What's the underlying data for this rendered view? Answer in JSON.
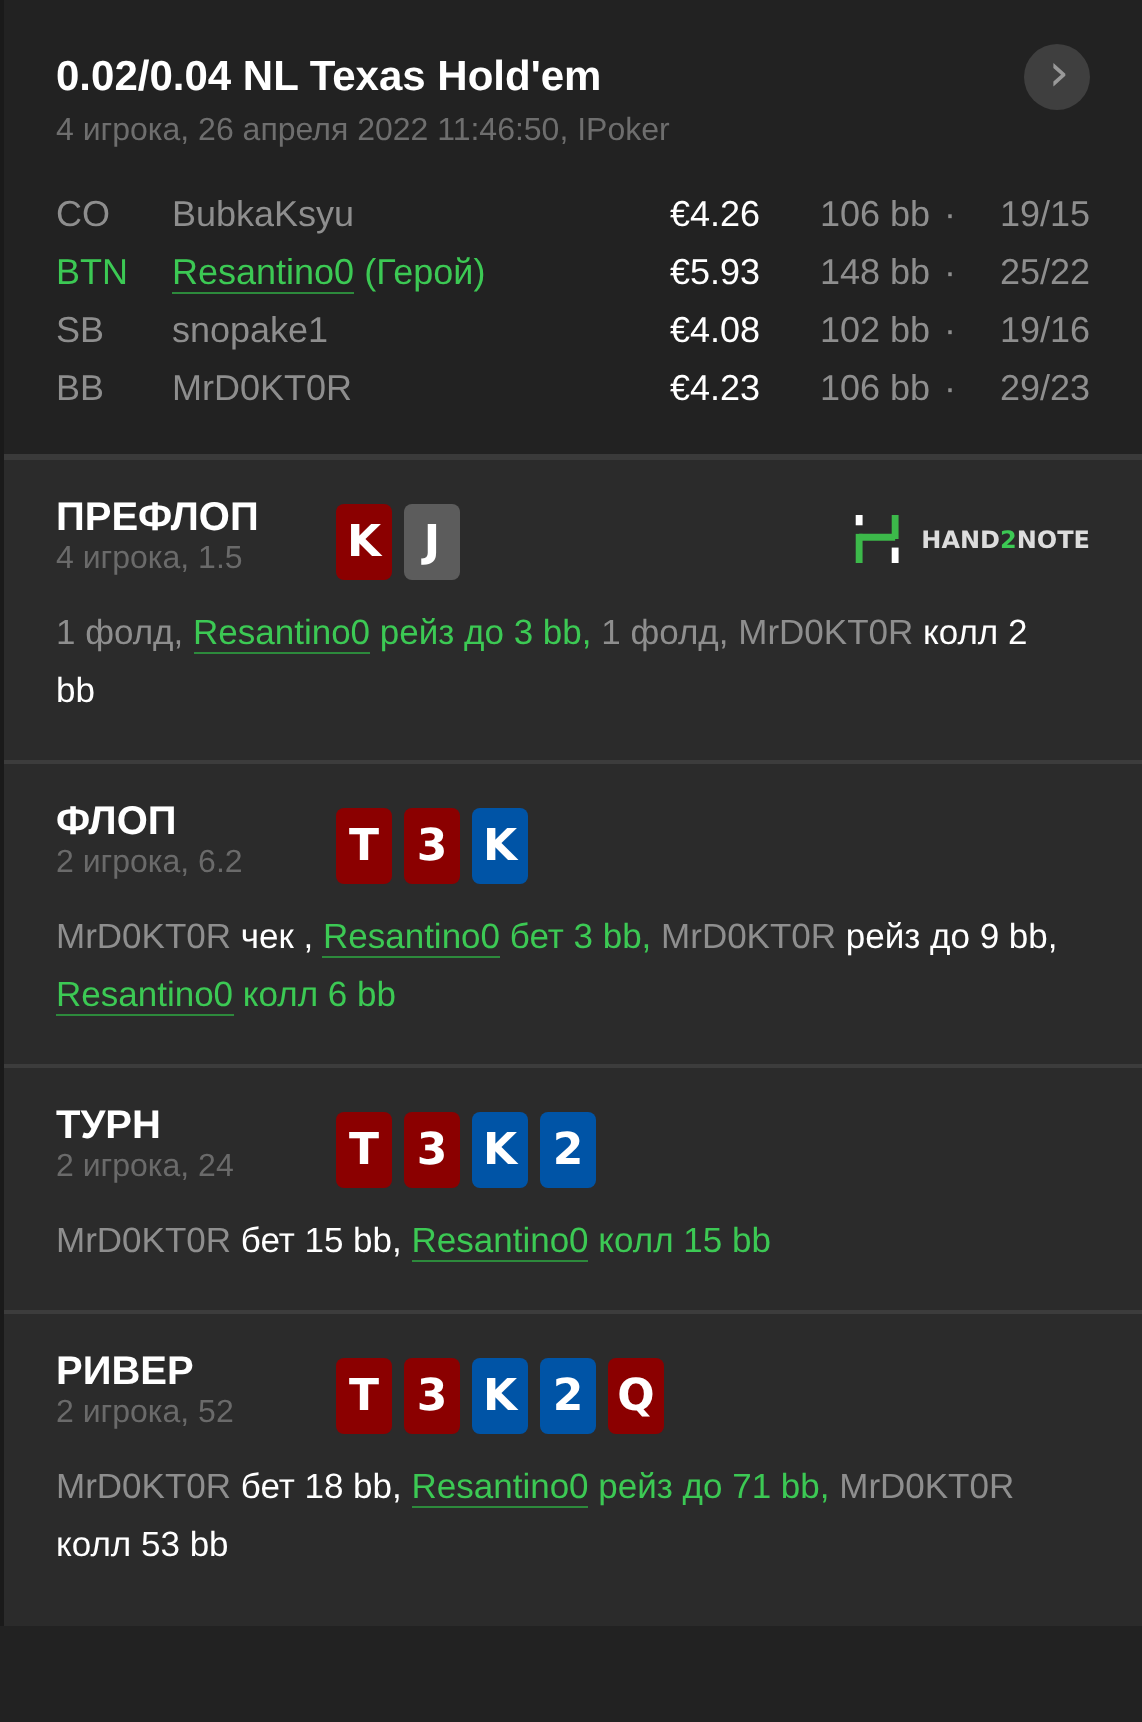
{
  "header": {
    "title": "0.02/0.04 NL Texas Hold'em",
    "subtitle": "4 игрока, 26 апреля 2022 11:46:50, IPoker",
    "next_button": "›"
  },
  "players": [
    {
      "position": "CO",
      "name": "BubkaKsyu",
      "hero": false,
      "stack": "€4.26",
      "bb": "106 bb",
      "separator": "·",
      "stats": "19/15"
    },
    {
      "position": "BTN",
      "name": "Resantino0",
      "hero": true,
      "hero_label": "(Герой)",
      "stack": "€5.93",
      "bb": "148 bb",
      "separator": "·",
      "stats": "25/22"
    },
    {
      "position": "SB",
      "name": "snopake1",
      "hero": false,
      "stack": "€4.08",
      "bb": "102 bb",
      "separator": "·",
      "stats": "19/16"
    },
    {
      "position": "BB",
      "name": "MrD0KT0R",
      "hero": false,
      "stack": "€4.23",
      "bb": "106 bb",
      "separator": "·",
      "stats": "29/23"
    }
  ],
  "streets": [
    {
      "title": "ПРЕФЛОП",
      "info": "4 игрока, 1.5",
      "logo": {
        "parts": [
          {
            "text": "HAND",
            "accent": false
          },
          {
            "text": "2",
            "accent": true
          },
          {
            "text": "NOTE",
            "accent": false
          }
        ]
      },
      "cards": [
        {
          "rank": "K",
          "color": "#8b0000"
        },
        {
          "rank": "J",
          "color": "#5c5c5c"
        }
      ],
      "actions": [
        {
          "kind": "plain",
          "text": "1 фолд, "
        },
        {
          "kind": "hero",
          "text": "Resantino0"
        },
        {
          "kind": "hero_action",
          "text": " рейз до 3 bb,"
        },
        {
          "kind": "plain",
          "text": " 1 фолд, MrD0KT0R"
        },
        {
          "kind": "action",
          "text": " колл 2 bb"
        }
      ]
    },
    {
      "title": "ФЛОП",
      "info": "2 игрока, 6.2",
      "cards": [
        {
          "rank": "T",
          "color": "#8b0000"
        },
        {
          "rank": "3",
          "color": "#8b0000"
        },
        {
          "rank": "K",
          "color": "#0054a6"
        }
      ],
      "actions": [
        {
          "kind": "plain",
          "text": "MrD0KT0R"
        },
        {
          "kind": "action",
          "text": " чек , "
        },
        {
          "kind": "hero",
          "text": "Resantino0"
        },
        {
          "kind": "hero_action",
          "text": " бет 3 bb,"
        },
        {
          "kind": "plain",
          "text": " MrD0KT0R"
        },
        {
          "kind": "action",
          "text": " рейз до 9 bb, "
        },
        {
          "kind": "hero",
          "text": "Resantino0"
        },
        {
          "kind": "hero_action",
          "text": " колл 6 bb"
        }
      ]
    },
    {
      "title": "ТУРН",
      "info": "2 игрока, 24",
      "cards": [
        {
          "rank": "T",
          "color": "#8b0000"
        },
        {
          "rank": "3",
          "color": "#8b0000"
        },
        {
          "rank": "K",
          "color": "#0054a6"
        },
        {
          "rank": "2",
          "color": "#0054a6"
        }
      ],
      "actions": [
        {
          "kind": "plain",
          "text": "MrD0KT0R"
        },
        {
          "kind": "action",
          "text": " бет 15 bb, "
        },
        {
          "kind": "hero",
          "text": "Resantino0"
        },
        {
          "kind": "hero_action",
          "text": " колл 15 bb"
        }
      ]
    },
    {
      "title": "РИВЕР",
      "info": "2 игрока, 52",
      "cards": [
        {
          "rank": "T",
          "color": "#8b0000"
        },
        {
          "rank": "3",
          "color": "#8b0000"
        },
        {
          "rank": "K",
          "color": "#0054a6"
        },
        {
          "rank": "2",
          "color": "#0054a6"
        },
        {
          "rank": "Q",
          "color": "#8b0000"
        }
      ],
      "actions": [
        {
          "kind": "plain",
          "text": "MrD0KT0R"
        },
        {
          "kind": "action",
          "text": " бет 18 bb, "
        },
        {
          "kind": "hero",
          "text": "Resantino0"
        },
        {
          "kind": "hero_action",
          "text": " рейз до 71 bb,"
        },
        {
          "kind": "plain",
          "text": " MrD0KT0R"
        },
        {
          "kind": "action",
          "text": " колл 53 bb"
        }
      ]
    }
  ]
}
